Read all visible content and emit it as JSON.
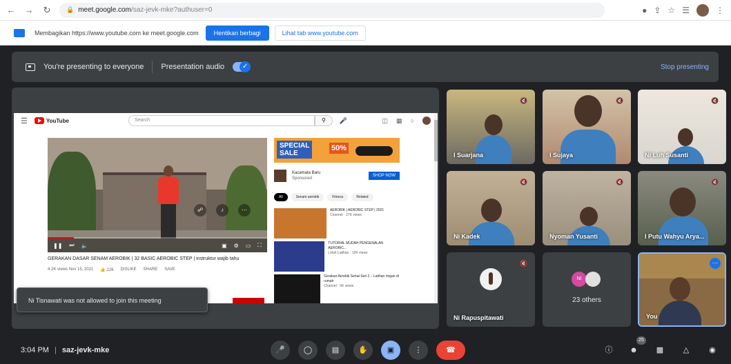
{
  "browser": {
    "url_host": "meet.google.com",
    "url_path": "/saz-jevk-mke?authuser=0"
  },
  "infobar": {
    "text": "Membagikan https://www.youtube.com ke meet.google.com",
    "primary_button": "Hentikan berbagi",
    "secondary_button": "Lihat tab www.youtube.com"
  },
  "banner": {
    "presenting_label": "You're presenting to everyone",
    "audio_label": "Presentation audio",
    "stop_label": "Stop presenting"
  },
  "youtube": {
    "logo_text": "YouTube",
    "search_placeholder": "Search",
    "video_title": "GERAKAN DASAR SENAM AEROBIK | 32 BASIC AEROBIC STEP | instruktur wajib tahu",
    "video_views": "4.2K views  Nov 15, 2021",
    "likes": "226",
    "dislike_label": "DISLIKE",
    "share_label": "SHARE",
    "save_label": "SAVE",
    "progress": 0.12,
    "ad": {
      "sale_line1": "SPECIAL",
      "sale_line2": "SALE",
      "percent": "50%",
      "advertiser": "Kacamata Baru",
      "advertiser_sub": "Sponsored",
      "shop_label": "SHOP NOW"
    },
    "chips": [
      "All",
      "Senam aerobik",
      "Fitness",
      "Related"
    ],
    "recommendations": [
      {
        "title": "AEROBIK | AEROBIC STEP | 2021",
        "meta": "Channel · 27K views",
        "thumb_color": "#c8762e"
      },
      {
        "title": "TUTORIAL MUDAH PENGENALAN AEROBIC...",
        "meta": "Lelah Latihan · 12K views",
        "thumb_color": "#2c3c8c"
      },
      {
        "title": "Gerakan Aerobik Sehat Seri 2 – Latihan ringan di rumah",
        "meta": "Channel · 5K views",
        "thumb_color": "#151515"
      }
    ]
  },
  "toast": "Ni Tisnawati was not allowed to join this meeting",
  "participants": [
    {
      "name": "I Suarjana",
      "bg": "#6c6a62",
      "wall": "#c9b77f"
    },
    {
      "name": "I Sujaya",
      "bg": "#b08a6f",
      "wall": "#d3c3a8"
    },
    {
      "name": "Ni Luh Susanti",
      "bg": "#d9d6cf",
      "wall": "#ede7de"
    },
    {
      "name": "Ni Kadek",
      "bg": "#9f8d72",
      "wall": "#c1b197"
    },
    {
      "name": "Nyoman Yusanti",
      "bg": "#9a8e7d",
      "wall": "#bfb3a0"
    },
    {
      "name": "I Putu Wahyu Arya...",
      "bg": "#58604d",
      "wall": "#8b8a80"
    }
  ],
  "bottom_tiles": {
    "ni_name": "Ni Rapuspitawati",
    "others_label": "23 others",
    "others_initials": "NI",
    "self_label": "You"
  },
  "call": {
    "time": "3:04 PM",
    "separator": "|",
    "code": "saz-jevk-mke",
    "participant_count": "25"
  },
  "colors": {
    "background": "#202124",
    "accent": "#8ab4f8",
    "end_call": "#ea4335"
  }
}
